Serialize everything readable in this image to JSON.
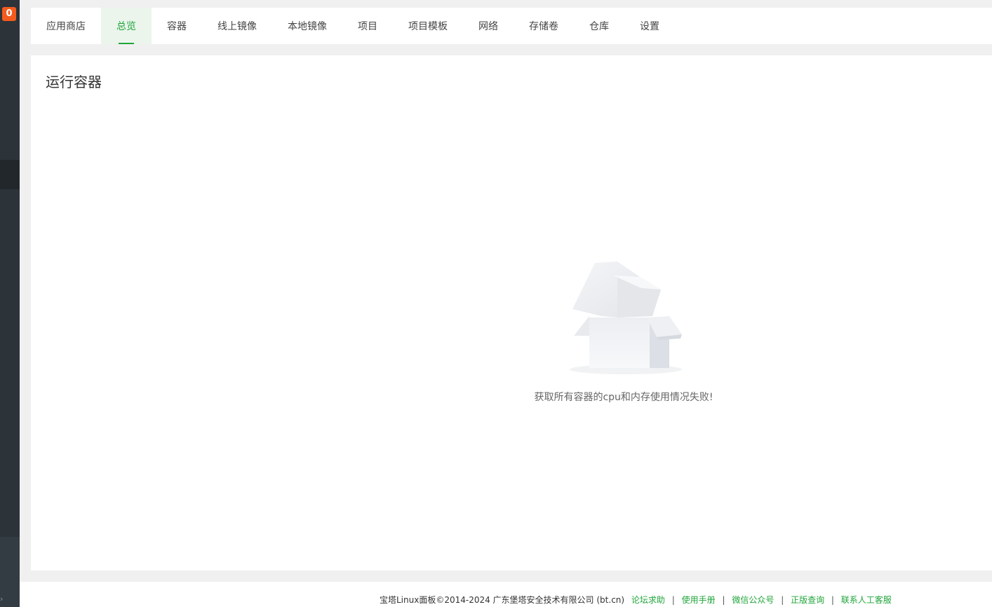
{
  "sidebar": {
    "badge_count": "0",
    "collapse_icon": "chevron-right-icon"
  },
  "tabs": [
    {
      "label": "应用商店",
      "active": false
    },
    {
      "label": "总览",
      "active": true
    },
    {
      "label": "容器",
      "active": false
    },
    {
      "label": "线上镜像",
      "active": false
    },
    {
      "label": "本地镜像",
      "active": false
    },
    {
      "label": "项目",
      "active": false
    },
    {
      "label": "项目模板",
      "active": false
    },
    {
      "label": "网络",
      "active": false
    },
    {
      "label": "存储卷",
      "active": false
    },
    {
      "label": "仓库",
      "active": false
    },
    {
      "label": "设置",
      "active": false
    }
  ],
  "main": {
    "title": "运行容器",
    "empty_message": "获取所有容器的cpu和内存使用情况失败!",
    "empty_icon": "empty-box-icon"
  },
  "footer": {
    "copyright": "宝塔Linux面板©2014-2024 广东堡塔安全技术有限公司 (bt.cn)",
    "links": [
      {
        "label": "论坛求助"
      },
      {
        "label": "使用手册"
      },
      {
        "label": "微信公众号"
      },
      {
        "label": "正版查询"
      },
      {
        "label": "联系人工客服"
      }
    ]
  },
  "colors": {
    "accent": "#20a53a",
    "badge": "#f25b1d",
    "sidebar": "#2c3339"
  }
}
